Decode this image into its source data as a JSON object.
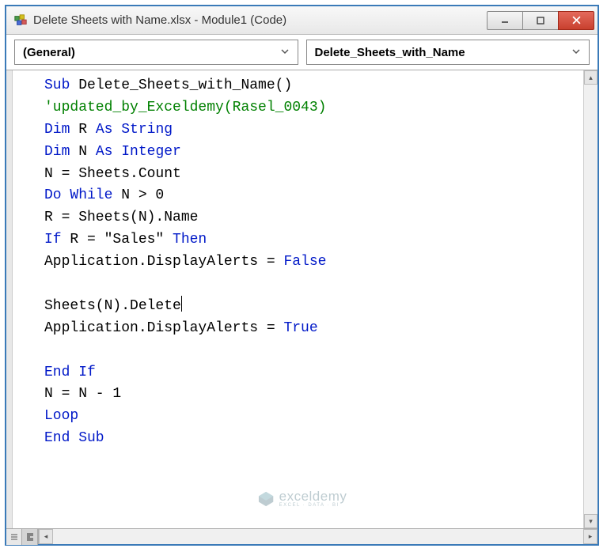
{
  "window": {
    "title": "Delete Sheets with Name.xlsx - Module1 (Code)"
  },
  "dropdowns": {
    "object": "(General)",
    "procedure": "Delete_Sheets_with_Name"
  },
  "code": {
    "lines": [
      [
        {
          "t": "kw",
          "v": "Sub "
        },
        {
          "t": "tx",
          "v": "Delete_Sheets_with_Name()"
        }
      ],
      [
        {
          "t": "cm",
          "v": "'updated_by_Exceldemy(Rasel_0043)"
        }
      ],
      [
        {
          "t": "kw",
          "v": "Dim "
        },
        {
          "t": "tx",
          "v": "R "
        },
        {
          "t": "kw",
          "v": "As String"
        }
      ],
      [
        {
          "t": "kw",
          "v": "Dim "
        },
        {
          "t": "tx",
          "v": "N "
        },
        {
          "t": "kw",
          "v": "As Integer"
        }
      ],
      [
        {
          "t": "tx",
          "v": "N = Sheets.Count"
        }
      ],
      [
        {
          "t": "kw",
          "v": "Do While "
        },
        {
          "t": "tx",
          "v": "N > 0"
        }
      ],
      [
        {
          "t": "tx",
          "v": "R = Sheets(N).Name"
        }
      ],
      [
        {
          "t": "kw",
          "v": "If "
        },
        {
          "t": "tx",
          "v": "R = \"Sales\" "
        },
        {
          "t": "kw",
          "v": "Then"
        }
      ],
      [
        {
          "t": "tx",
          "v": "Application.DisplayAlerts = "
        },
        {
          "t": "kw",
          "v": "False"
        }
      ],
      [
        {
          "t": "tx",
          "v": ""
        }
      ],
      [
        {
          "t": "tx",
          "v": "Sheets(N).Delete"
        },
        {
          "t": "cursor",
          "v": ""
        }
      ],
      [
        {
          "t": "tx",
          "v": "Application.DisplayAlerts = "
        },
        {
          "t": "kw",
          "v": "True"
        }
      ],
      [
        {
          "t": "tx",
          "v": ""
        }
      ],
      [
        {
          "t": "kw",
          "v": "End If"
        }
      ],
      [
        {
          "t": "tx",
          "v": "N = N - 1"
        }
      ],
      [
        {
          "t": "kw",
          "v": "Loop"
        }
      ],
      [
        {
          "t": "kw",
          "v": "End Sub"
        }
      ]
    ]
  },
  "watermark": {
    "main": "exceldemy",
    "sub": "EXCEL · DATA · BI"
  }
}
